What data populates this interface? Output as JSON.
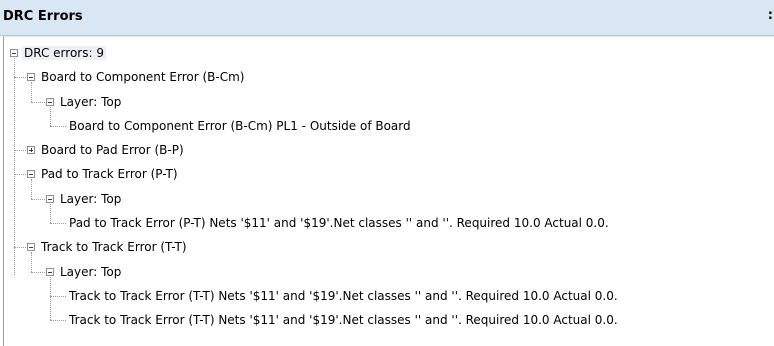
{
  "panel": {
    "title": "DRC Errors",
    "pin_glyph": ":"
  },
  "tree": {
    "root": "DRC errors: 9",
    "groups": [
      {
        "label": "Board to Component Error (B-Cm)",
        "layer": "Layer: Top",
        "items": [
          "Board to Component Error (B-Cm) PL1 - Outside of Board"
        ]
      },
      {
        "label": "Board to Pad Error (B-P)",
        "collapsed": true
      },
      {
        "label": "Pad to Track Error (P-T)",
        "layer": "Layer: Top",
        "items": [
          "Pad to Track Error (P-T) Nets '$11' and '$19'.Net classes '' and ''. Required 10.0 Actual 0.0."
        ]
      },
      {
        "label": "Track to Track Error (T-T)",
        "layer": "Layer: Top",
        "items": [
          "Track to Track Error (T-T) Nets '$11' and '$19'.Net classes '' and ''. Required 10.0 Actual 0.0.",
          "Track to Track Error (T-T) Nets '$11' and '$19'.Net classes '' and ''. Required 10.0 Actual 0.0."
        ]
      }
    ]
  }
}
